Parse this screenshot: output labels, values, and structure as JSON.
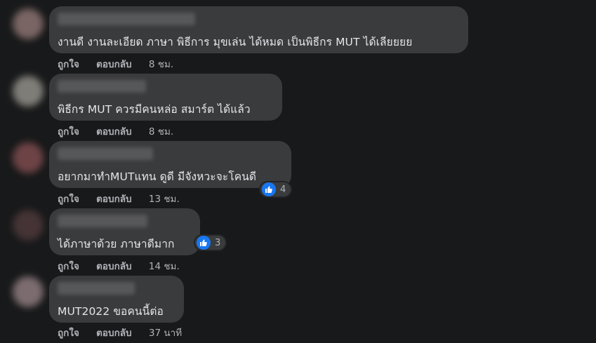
{
  "comments": [
    {
      "text": "งานดี งานละเอียด ภาษา พิธีการ มุขเล่น ได้หมด เป็นพิธีกร MUT ได้เลียยยย",
      "like_label": "ถูกใจ",
      "reply_label": "ตอบกลับ",
      "time": "8 ชม."
    },
    {
      "text": "พิธีกร MUT ควรมีคนหล่อ สมาร์ต ได้แล้ว",
      "like_label": "ถูกใจ",
      "reply_label": "ตอบกลับ",
      "time": "8 ชม."
    },
    {
      "text": "อยากมาทำMUTแทน ดูดี มีจังหวะจะโคนดี",
      "like_label": "ถูกใจ",
      "reply_label": "ตอบกลับ",
      "time": "13 ชม.",
      "reaction_count": "4"
    },
    {
      "text": "ได้ภาษาด้วย ภาษาดีมาก",
      "like_label": "ถูกใจ",
      "reply_label": "ตอบกลับ",
      "time": "14 ชม.",
      "reaction_count": "3"
    },
    {
      "text": "MUT2022 ขอคนนี้ต่อ",
      "like_label": "ถูกใจ",
      "reply_label": "ตอบกลับ",
      "time": "37 นาที"
    }
  ],
  "colors": {
    "background": "#18191a",
    "bubble": "#3a3b3c",
    "text": "#e4e6eb",
    "secondary_text": "#b0b3b8",
    "like_blue": "#1877f2"
  },
  "icons": {
    "reaction": "thumbs-up-icon"
  }
}
